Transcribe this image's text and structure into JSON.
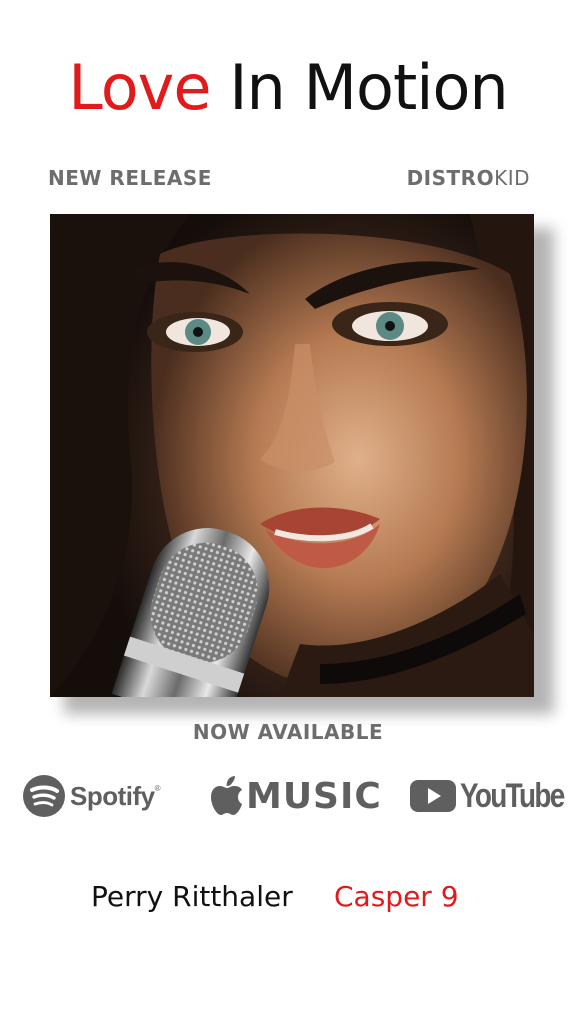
{
  "title": {
    "word1": "Love",
    "word2": "In Motion"
  },
  "labels": {
    "left": "NEW RELEASE",
    "right_bold": "DISTRO",
    "right_light": "KID"
  },
  "cover": {
    "icon": "microphone-portrait"
  },
  "availability": "NOW AVAILABLE",
  "platforms": {
    "spotify": {
      "label": "Spotify",
      "tm": "®"
    },
    "apple": {
      "label": "MUSIC"
    },
    "youtube": {
      "label": "YouTube"
    }
  },
  "credits": {
    "artist": "Perry Ritthaler",
    "collaborator": "Casper 9"
  },
  "colors": {
    "accent": "#e11b1b",
    "gray_text": "#6d6d6d",
    "logo_gray": "#5f5f5f"
  }
}
